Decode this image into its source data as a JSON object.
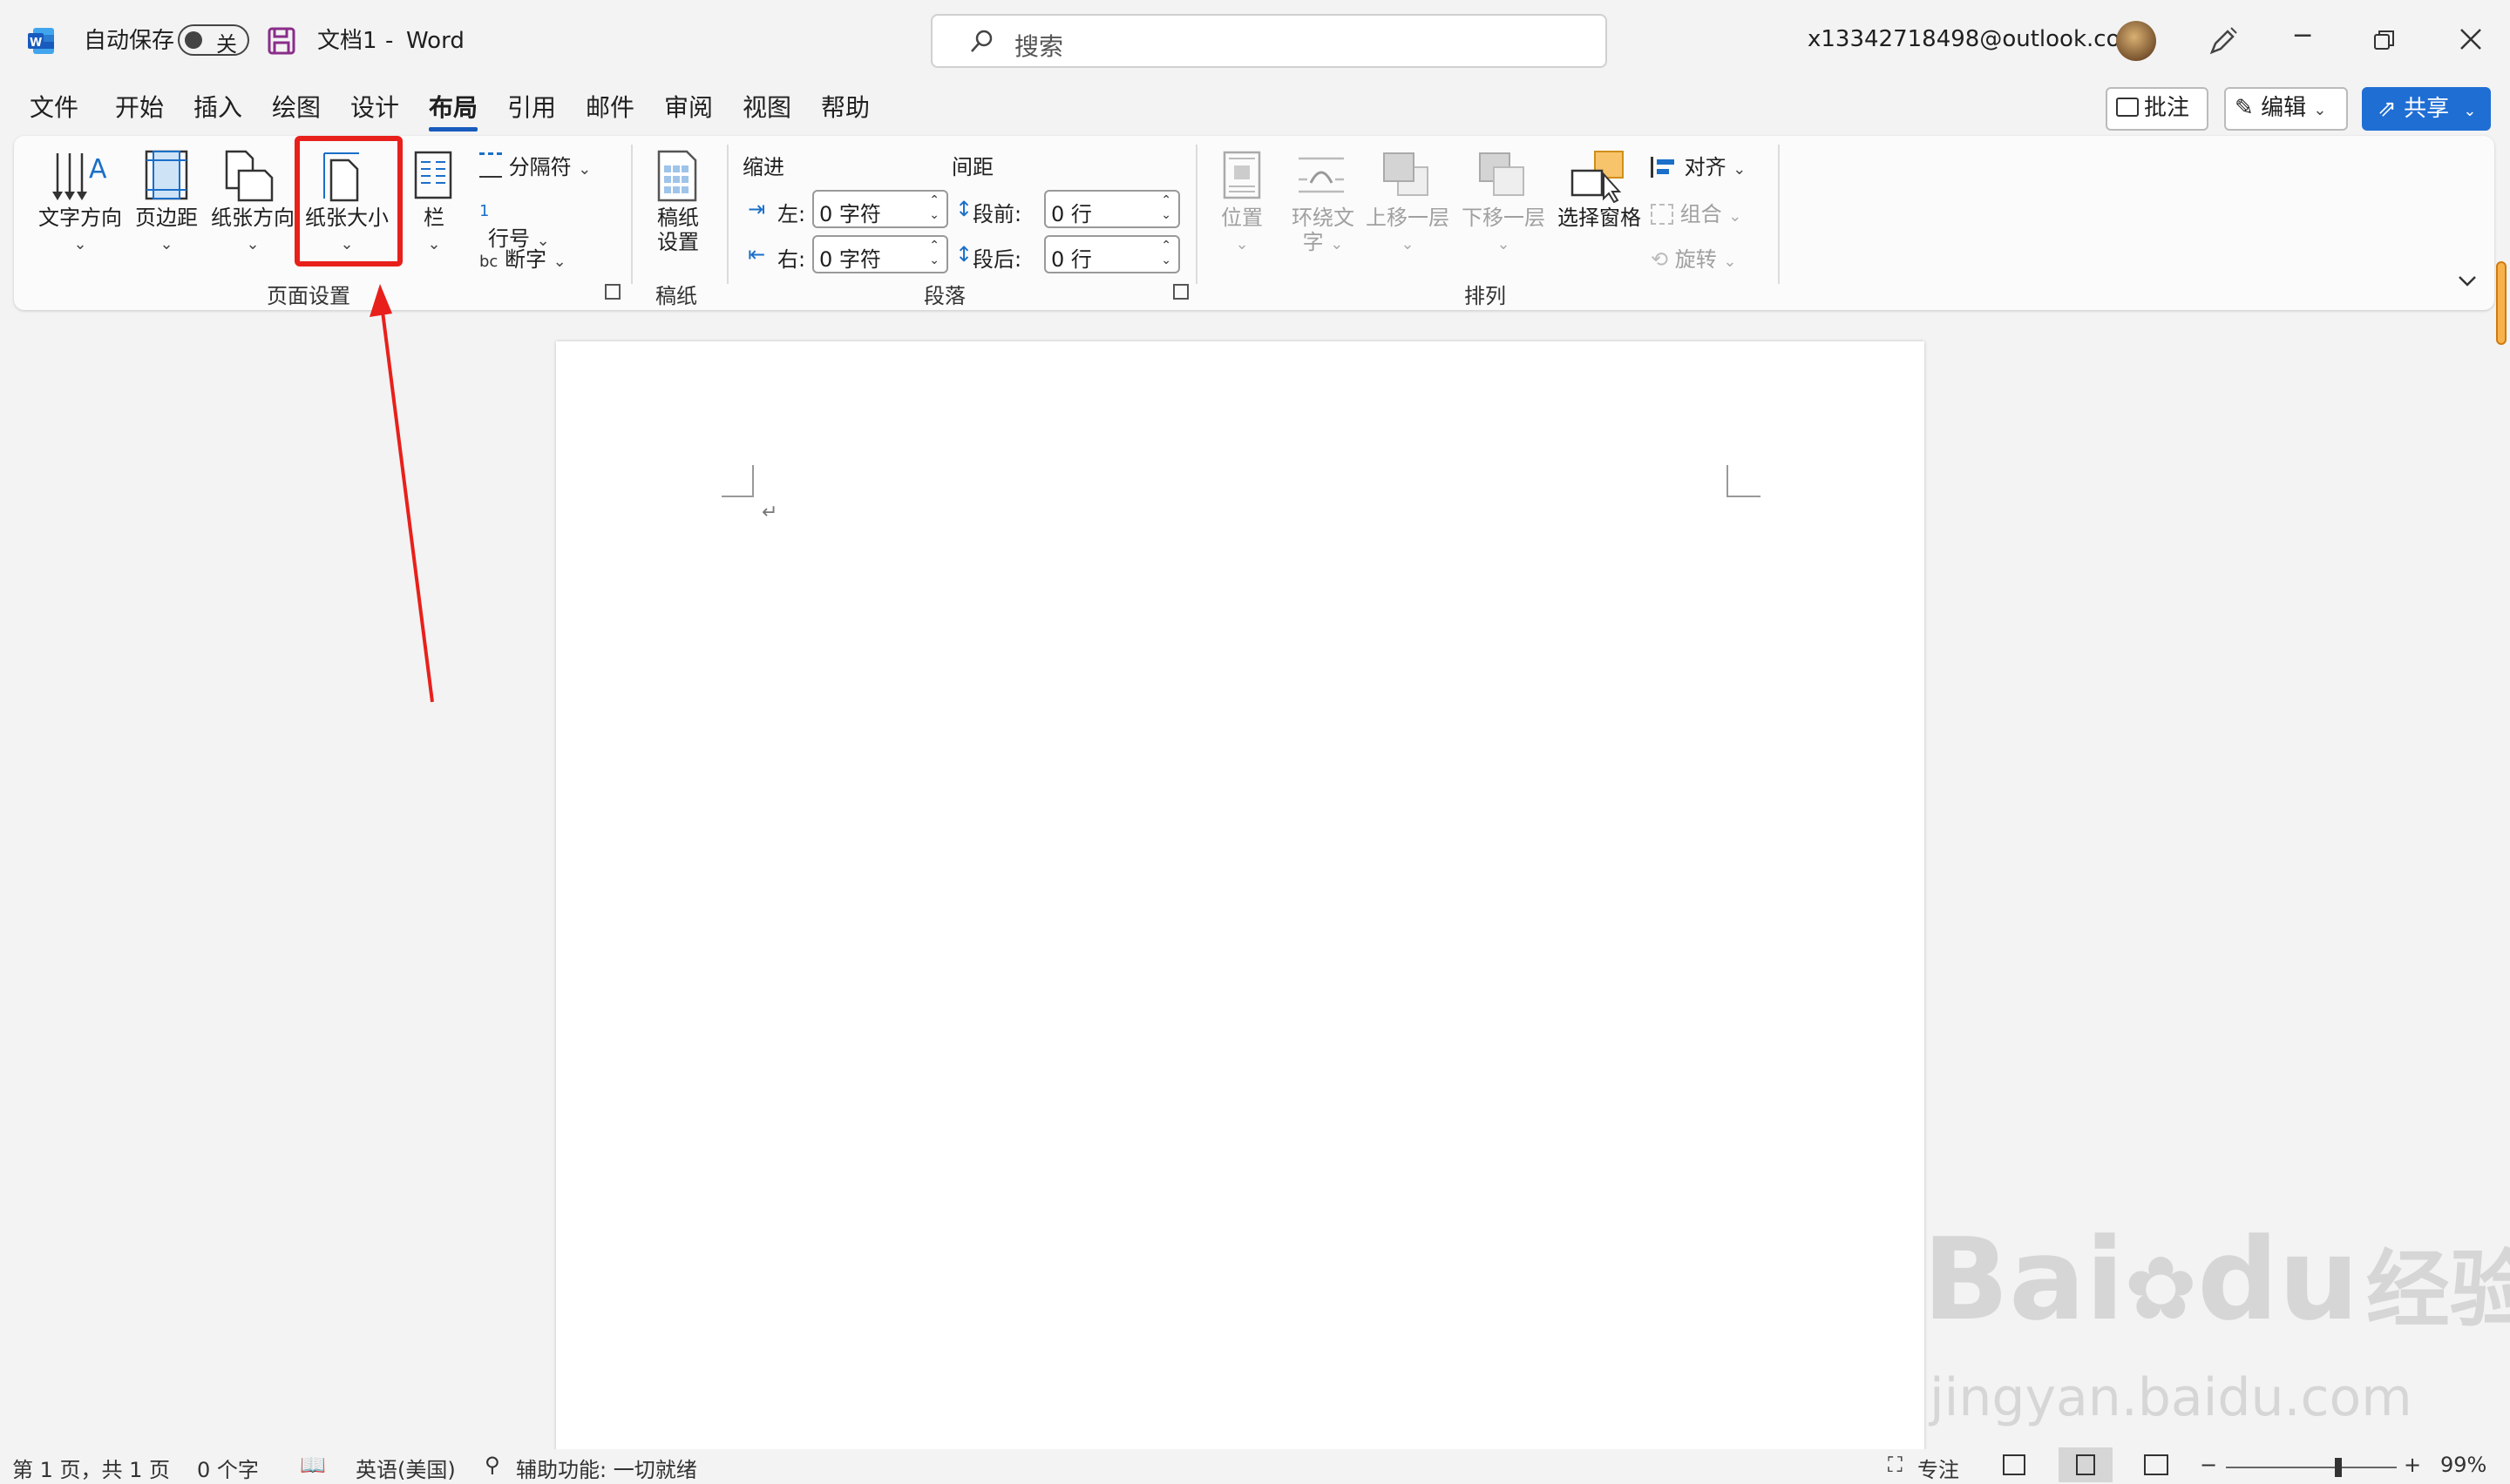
{
  "titlebar": {
    "autosave_label": "自动保存",
    "autosave_state": "关",
    "doc_title": "文档1",
    "separator": "-",
    "app_name": "Word",
    "search_placeholder": "搜索",
    "account": "x13342718498@outlook.com"
  },
  "menu": {
    "tabs": [
      "文件",
      "开始",
      "插入",
      "绘图",
      "设计",
      "布局",
      "引用",
      "邮件",
      "审阅",
      "视图",
      "帮助"
    ],
    "active_tab": "布局",
    "comments_label": "批注",
    "editing_label": "编辑",
    "share_label": "共享"
  },
  "ribbon": {
    "page_setup": {
      "text_direction": "文字方向",
      "margins": "页边距",
      "orientation": "纸张方向",
      "size": "纸张大小",
      "columns": "栏",
      "breaks": "分隔符",
      "line_numbers": "行号",
      "hyphenation": "断字",
      "group_label": "页面设置"
    },
    "manuscript": {
      "setup_line1": "稿纸",
      "setup_line2": "设置",
      "group_label": "稿纸"
    },
    "paragraph": {
      "indent_header": "缩进",
      "spacing_header": "间距",
      "left_label": "左:",
      "left_value": "0 字符",
      "right_label": "右:",
      "right_value": "0 字符",
      "before_label": "段前:",
      "before_value": "0 行",
      "after_label": "段后:",
      "after_value": "0 行",
      "group_label": "段落"
    },
    "arrange": {
      "position": "位置",
      "wrap_line1": "环绕文",
      "wrap_line2": "字",
      "bring_forward": "上移一层",
      "send_backward": "下移一层",
      "selection_pane": "选择窗格",
      "align": "对齐",
      "group": "组合",
      "rotate": "旋转",
      "group_label": "排列"
    }
  },
  "status": {
    "page": "第 1 页，共 1 页",
    "words": "0 个字",
    "language": "英语(美国)",
    "accessibility": "辅助功能: 一切就绪",
    "focus": "专注",
    "zoom": "99%",
    "zoom_level": 0.66
  },
  "document": {
    "paragraph_mark": "↵"
  },
  "watermark": {
    "line1": "Bai",
    "line2": "du",
    "line3": "经验",
    "url": "jingyan.baidu.com"
  },
  "colors": {
    "accent": "#185abd",
    "share": "#1f6ed4",
    "highlight": "#e8201b"
  }
}
